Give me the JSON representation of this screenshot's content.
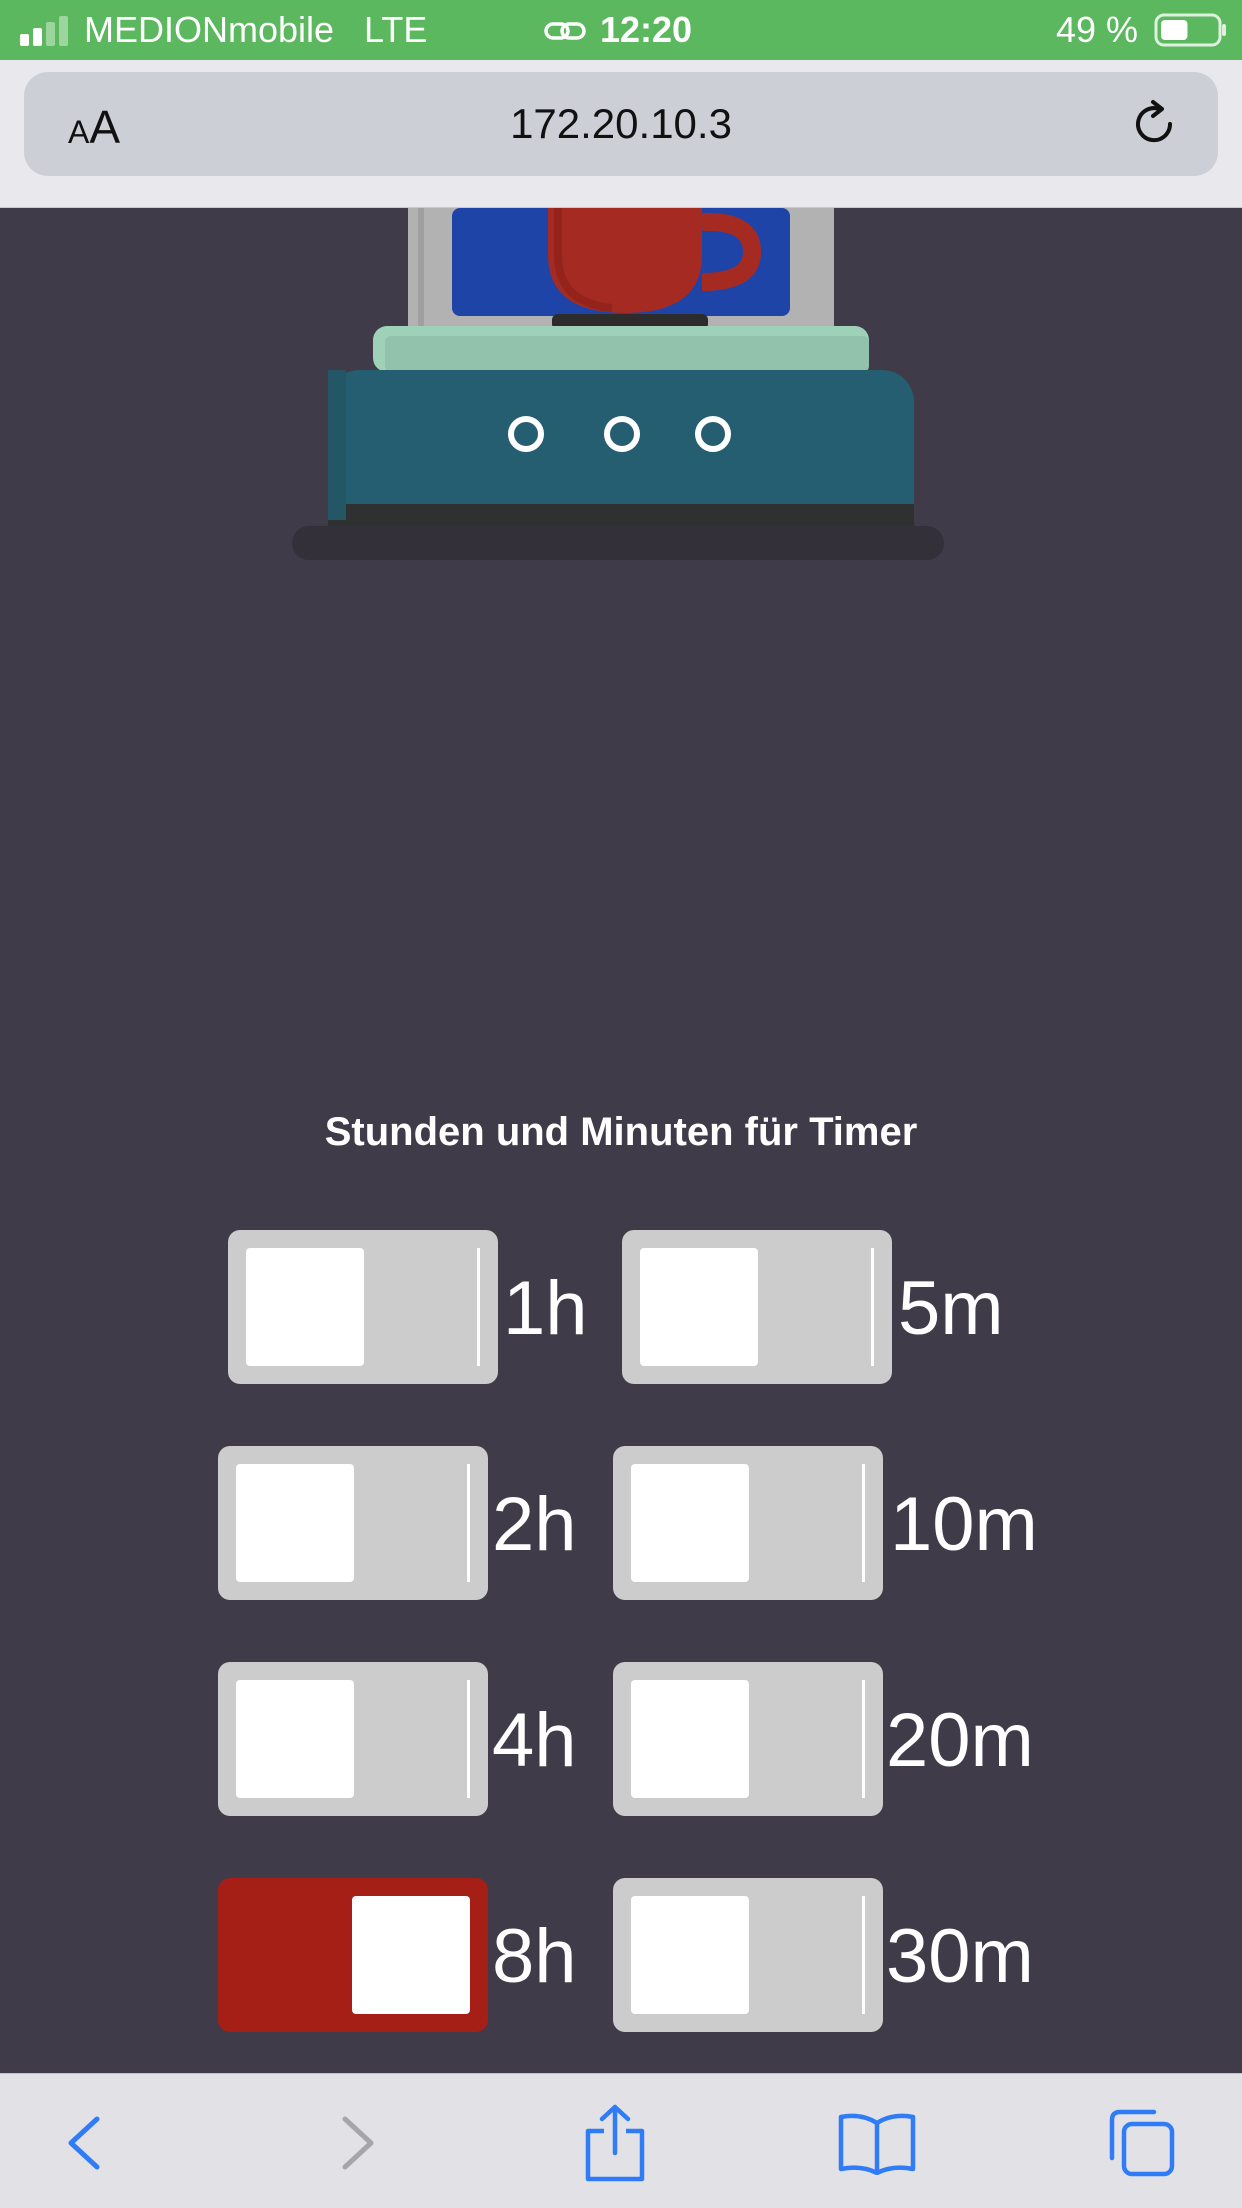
{
  "status_bar": {
    "carrier": "MEDIONmobile",
    "network": "LTE",
    "time": "12:20",
    "battery": "49 %",
    "battery_level": 0.49
  },
  "browser": {
    "text_size_label_small": "A",
    "text_size_label_large": "A",
    "url": "172.20.10.3"
  },
  "main": {
    "heading": "Stunden und Minuten für Timer",
    "hours": [
      {
        "label": "1h",
        "on": false
      },
      {
        "label": "2h",
        "on": false
      },
      {
        "label": "4h",
        "on": false
      },
      {
        "label": "8h",
        "on": true
      }
    ],
    "minutes": [
      {
        "label": "5m",
        "on": false
      },
      {
        "label": "10m",
        "on": false
      },
      {
        "label": "20m",
        "on": false
      },
      {
        "label": "30m",
        "on": false
      }
    ]
  },
  "colors": {
    "background": "#3f3b48",
    "status_bar": "#5cb85f",
    "toggle_on": "#a51f17",
    "toggle_off": "#cccccc",
    "ios_blue": "#2f7cf6"
  },
  "icons": [
    "signal-icon",
    "link-icon",
    "battery-icon",
    "reload-icon",
    "back-icon",
    "forward-icon",
    "share-icon",
    "bookmarks-icon",
    "tabs-icon"
  ]
}
